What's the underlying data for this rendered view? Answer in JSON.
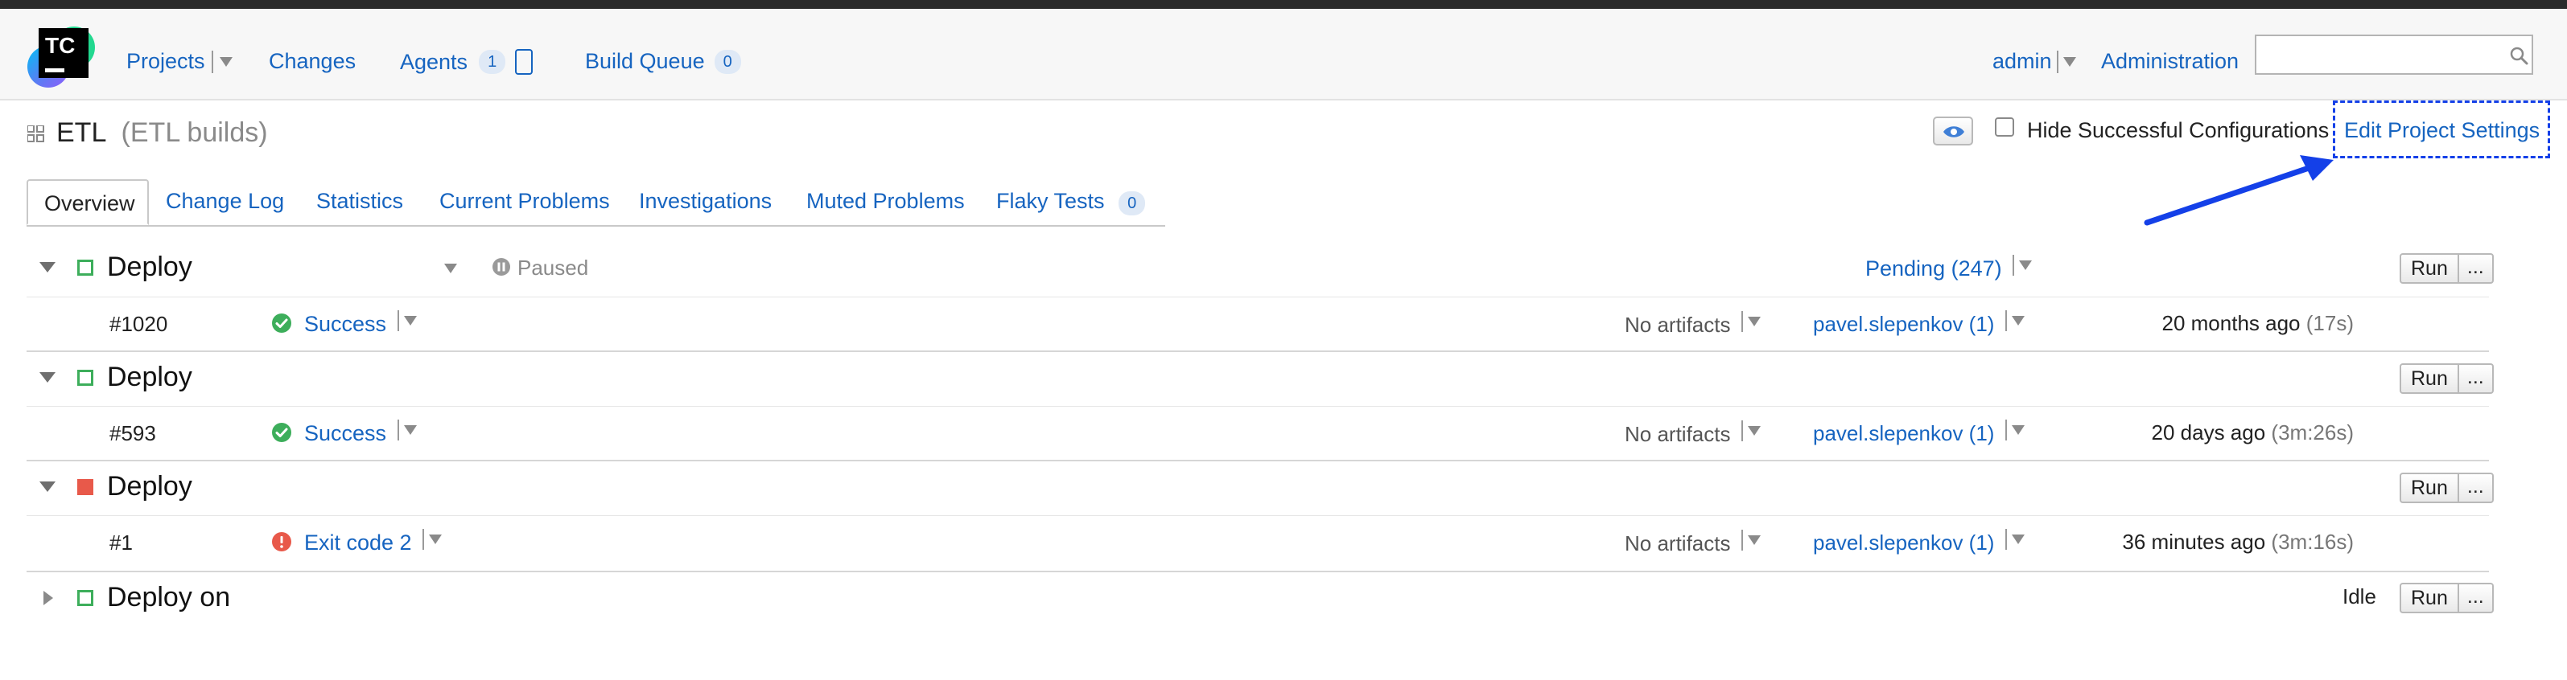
{
  "header": {
    "logo_text": "TC",
    "nav": {
      "projects": "Projects",
      "changes": "Changes",
      "agents": "Agents",
      "agents_count": "1",
      "build_queue": "Build Queue",
      "build_queue_count": "0"
    },
    "user": "admin",
    "administration": "Administration",
    "search_placeholder": ""
  },
  "project": {
    "name": "ETL",
    "description": "(ETL builds)",
    "hide_successful_label": "Hide Successful Configurations",
    "edit_settings": "Edit Project Settings"
  },
  "tabs": [
    {
      "label": "Overview"
    },
    {
      "label": "Change Log"
    },
    {
      "label": "Statistics"
    },
    {
      "label": "Current Problems"
    },
    {
      "label": "Investigations"
    },
    {
      "label": "Muted Problems"
    },
    {
      "label": "Flaky Tests",
      "count": "0"
    }
  ],
  "configs": [
    {
      "name": "Deploy",
      "paused": "Paused",
      "pending": "Pending (247)",
      "run": "Run",
      "more": "...",
      "build": {
        "number": "#1020",
        "status": "Success",
        "artifacts": "No artifacts",
        "user": "pavel.slepenkov (1)",
        "time": "20 months ago",
        "duration": "(17s)"
      }
    },
    {
      "name": "Deploy",
      "run": "Run",
      "more": "...",
      "build": {
        "number": "#593",
        "status": "Success",
        "artifacts": "No artifacts",
        "user": "pavel.slepenkov (1)",
        "time": "20 days ago",
        "duration": "(3m:26s)"
      }
    },
    {
      "name": "Deploy",
      "run": "Run",
      "more": "...",
      "build": {
        "number": "#1",
        "status": "Exit code 2",
        "artifacts": "No artifacts",
        "user": "pavel.slepenkov (1)",
        "time": "36 minutes ago",
        "duration": "(3m:16s)"
      }
    },
    {
      "name": "Deploy on",
      "idle": "Idle",
      "run": "Run",
      "more": "..."
    }
  ],
  "colors": {
    "link": "#1664c0",
    "success": "#3dae5b",
    "failure": "#e8594a",
    "annotation": "#1440e8"
  }
}
